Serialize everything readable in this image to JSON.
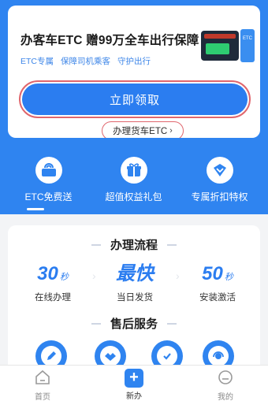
{
  "promo": {
    "title": "办客车ETC 赠99万全车出行保障",
    "tags": [
      "ETC专属",
      "保障司机乘客",
      "守护出行"
    ],
    "apply_button": "立即领取",
    "truck_link": "办理货车ETC",
    "truck_chevron": "›",
    "device_label": "ETC"
  },
  "features": [
    {
      "label": "ETC免费送",
      "icon": "etc-device-icon"
    },
    {
      "label": "超值权益礼包",
      "icon": "gift-icon"
    },
    {
      "label": "专属折扣特权",
      "icon": "discount-badge-icon"
    }
  ],
  "process": {
    "title": "办理流程",
    "steps": [
      {
        "value": "30",
        "unit": "秒",
        "desc": "在线办理"
      },
      {
        "value": "最快",
        "unit": "",
        "desc": "当日发货"
      },
      {
        "value": "50",
        "unit": "秒",
        "desc": "安装激活"
      }
    ],
    "arrow": "›"
  },
  "service": {
    "title": "售后服务",
    "icons": [
      "edit-icon",
      "handshake-icon",
      "shield-check-icon",
      "customer-service-icon"
    ]
  },
  "nav": {
    "home": "首页",
    "apply": "新办",
    "mine": "我的",
    "plus": "+"
  },
  "colors": {
    "primary": "#2f84f0",
    "highlight_ring": "#e0666d",
    "background": "#f3f4f6"
  }
}
